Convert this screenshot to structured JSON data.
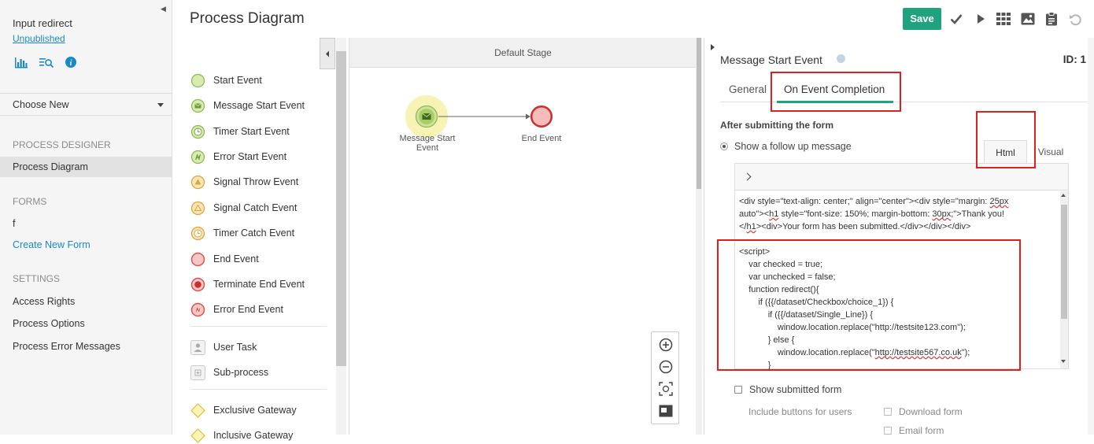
{
  "sidebar": {
    "app_title": "Input redirect",
    "status_link": "Unpublished",
    "icons": [
      "bar-chart-icon",
      "search-list-icon",
      "info-icon"
    ],
    "choose_new": "Choose New",
    "sections": {
      "designer": "PROCESS DESIGNER",
      "forms": "FORMS",
      "settings": "SETTINGS"
    },
    "items": {
      "process_diagram": "Process Diagram",
      "form_f": "f",
      "create_form": "Create New Form",
      "access_rights": "Access Rights",
      "process_options": "Process Options",
      "process_errors": "Process Error Messages"
    }
  },
  "header": {
    "title": "Process Diagram",
    "save_label": "Save",
    "tools": [
      "check-icon",
      "play-icon",
      "grid-icon",
      "image-icon",
      "clipboard-icon",
      "undo-icon"
    ]
  },
  "palette": {
    "items": [
      {
        "label": "Start Event",
        "shape": "start-event-icon"
      },
      {
        "label": "Message Start Event",
        "shape": "message-start-event-icon"
      },
      {
        "label": "Timer Start Event",
        "shape": "timer-start-event-icon"
      },
      {
        "label": "Error Start Event",
        "shape": "error-start-event-icon"
      },
      {
        "label": "Signal Throw Event",
        "shape": "signal-throw-event-icon"
      },
      {
        "label": "Signal Catch Event",
        "shape": "signal-catch-event-icon"
      },
      {
        "label": "Timer Catch Event",
        "shape": "timer-catch-event-icon"
      },
      {
        "label": "End Event",
        "shape": "end-event-icon"
      },
      {
        "label": "Terminate End Event",
        "shape": "terminate-end-event-icon"
      },
      {
        "label": "Error End Event",
        "shape": "error-end-event-icon"
      },
      {
        "label": "User Task",
        "shape": "user-task-icon"
      },
      {
        "label": "Sub-process",
        "shape": "sub-process-icon"
      },
      {
        "label": "Exclusive Gateway",
        "shape": "exclusive-gateway-icon"
      },
      {
        "label": "Inclusive Gateway",
        "shape": "inclusive-gateway-icon"
      }
    ]
  },
  "canvas": {
    "stage_label": "Default Stage",
    "nodes": {
      "start_label_line1": "Message Start",
      "start_label_line2": "Event",
      "end_label": "End Event"
    },
    "zoom_controls": [
      "zoom-in-icon",
      "zoom-out-icon",
      "fit-screen-icon",
      "minimap-icon"
    ]
  },
  "properties": {
    "title": "Message Start Event",
    "id_label": "ID: 1",
    "tabs": {
      "general": "General",
      "completion": "On Event Completion"
    },
    "after_submit_label": "After submitting the form",
    "follow_up_label": "Show a follow up message",
    "mode_tabs": {
      "html": "Html",
      "visual": "Visual"
    },
    "code": {
      "l1_a": "<div style=\"text-align: center;\" align=\"center\"><div style=\"margin: ",
      "l1_b": "25px",
      "l2_a": "auto\"><",
      "l2_b": "h1",
      "l2_c": " style=\"font-size: 150%; margin-bottom: ",
      "l2_d": "30px",
      "l2_e": ";\">Thank you!",
      "l3_a": "</",
      "l3_b": "h1",
      "l3_c": "><div>Your form has been submitted.</div></div></div>",
      "l4": "<script>",
      "l5": "    var checked = true;",
      "l6": "    var unchecked = false;",
      "l7": "    function redirect(){",
      "l8": "        if ({{/dataset/Checkbox/choice_1}) {",
      "l9": "            if ({{/dataset/Single_Line}) {",
      "l10": "                window.location.replace(\"http://testsite123.com\");",
      "l11": "            } else {",
      "l12_a": "                window.location.replace(\"",
      "l12_b": "http://testsite567.co.uk",
      "l12_c": "\");",
      "l13": "            }"
    },
    "show_submitted_label": "Show submitted form",
    "include_buttons_label": "Include buttons for users",
    "download_form_label": "Download form",
    "email_form_label": "Email form"
  },
  "colors": {
    "accent": "#20a27e",
    "link": "#1a8ac6",
    "highlight_box": "#e02020"
  }
}
